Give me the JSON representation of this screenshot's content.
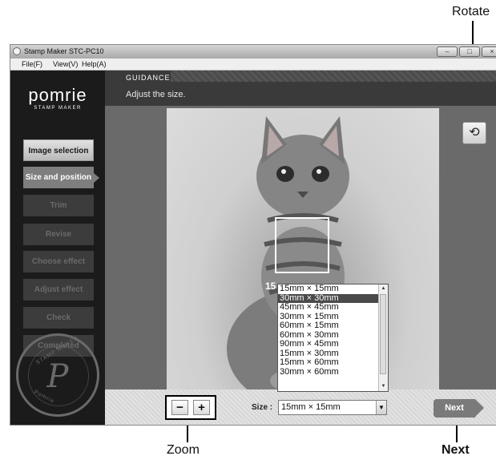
{
  "callouts": {
    "rotate": "Rotate",
    "zoom": "Zoom",
    "next": "Next"
  },
  "window": {
    "title": "Stamp Maker STC-PC10",
    "controls": {
      "minimize": "–",
      "maximize": "□",
      "close": "×"
    },
    "menu": [
      "File(F)",
      "View(V)",
      "Help(A)"
    ]
  },
  "sidebar": {
    "logo": "pomrie",
    "logo_sub": "STAMP MAKER",
    "steps": [
      {
        "label": "Image selection",
        "state": "done"
      },
      {
        "label": "Size and position",
        "state": "active"
      },
      {
        "label": "Trim",
        "state": "disabled"
      },
      {
        "label": "Revise",
        "state": "disabled"
      },
      {
        "label": "Choose effect",
        "state": "disabled"
      },
      {
        "label": "Adjust effect",
        "state": "disabled"
      },
      {
        "label": "Check",
        "state": "disabled"
      },
      {
        "label": "Completed",
        "state": "disabled"
      }
    ],
    "seal": {
      "letter": "P",
      "top_text": "STAMP MAKER",
      "bottom_text": "Pomrie"
    }
  },
  "guidance": {
    "label": "GUIDANCE",
    "text": "Adjust the size."
  },
  "workspace": {
    "size_preview": "15",
    "rotate_icon": "rotate-icon"
  },
  "bottombar": {
    "zoom_out": "−",
    "zoom_in": "+",
    "size_label": "Size :",
    "size_value": "15mm × 15mm",
    "next_label": "Next"
  },
  "size_options": [
    "15mm × 15mm",
    "30mm × 30mm",
    "45mm × 45mm",
    "30mm × 15mm",
    "60mm × 15mm",
    "60mm × 30mm",
    "90mm × 45mm",
    "15mm × 30mm",
    "15mm × 60mm",
    "30mm × 60mm"
  ],
  "highlighted_option": "30mm × 30mm",
  "colors": {
    "sidebar": "#1b1b1b",
    "accent": "#7a7a7a",
    "highlight": "#4a4a4a"
  }
}
